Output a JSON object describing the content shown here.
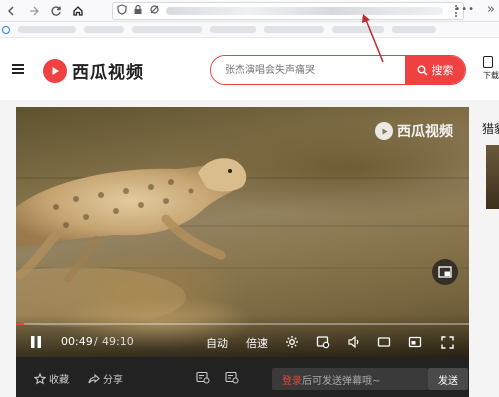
{
  "browser": {
    "icons": [
      "back-icon",
      "forward-icon",
      "reload-icon",
      "home-icon",
      "shield-icon",
      "lock-icon",
      "permissions-icon",
      "more-icon",
      "chevron-right-icon"
    ],
    "more_label": "•••",
    "chevron_label": "»"
  },
  "header": {
    "logo_text": "西瓜视频",
    "search_placeholder": "张杰演唱会失声痛哭",
    "search_button": "搜索",
    "download_label": "下载"
  },
  "player": {
    "watermark": "西瓜视频",
    "current_time": "00:49",
    "separator": " / ",
    "duration": "49:10",
    "progress": 0.017,
    "auto_label": "自动",
    "speed_label": "倍速"
  },
  "sidebar": {
    "title": "猎豹"
  },
  "actions": {
    "favorite_label": "收藏",
    "share_label": "分享",
    "danmu_login": "登录",
    "danmu_placeholder": "后可发送弹幕哦~",
    "send_label": "发送"
  },
  "colors": {
    "brand": "#f04142",
    "player_bar": "#222222"
  }
}
